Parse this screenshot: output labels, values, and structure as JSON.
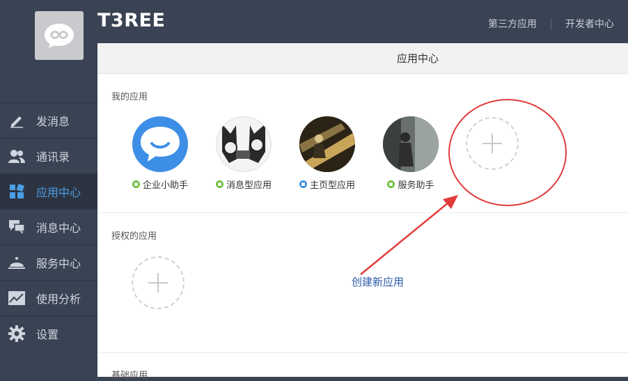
{
  "header": {
    "app_title": "T3REE",
    "links": [
      "第三方应用",
      "开发者中心"
    ]
  },
  "sidebar": {
    "items": [
      {
        "label": "发消息",
        "icon": "pencil-icon",
        "active": false
      },
      {
        "label": "通讯录",
        "icon": "contacts-icon",
        "active": false
      },
      {
        "label": "应用中心",
        "icon": "apps-icon",
        "active": true
      },
      {
        "label": "消息中心",
        "icon": "chat-icon",
        "active": false
      },
      {
        "label": "服务中心",
        "icon": "bell-icon",
        "active": false
      },
      {
        "label": "使用分析",
        "icon": "chart-icon",
        "active": false
      },
      {
        "label": "设置",
        "icon": "gear-icon",
        "active": false
      }
    ]
  },
  "main": {
    "title": "应用中心",
    "my_apps": {
      "title": "我的应用",
      "apps": [
        {
          "label": "企业小助手",
          "badge": "green"
        },
        {
          "label": "消息型应用",
          "badge": "green"
        },
        {
          "label": "主页型应用",
          "badge": "blue"
        },
        {
          "label": "服务助手",
          "badge": "green"
        }
      ]
    },
    "authorized_apps": {
      "title": "授权的应用"
    },
    "basic_apps": {
      "title": "基础应用"
    },
    "annotation": "创建新应用"
  },
  "colors": {
    "sidebar_bg": "#3a4353",
    "active_text": "#4a9ee6",
    "annotation_red": "#e23b3b",
    "annotation_blue_text": "#2c5aa8"
  }
}
